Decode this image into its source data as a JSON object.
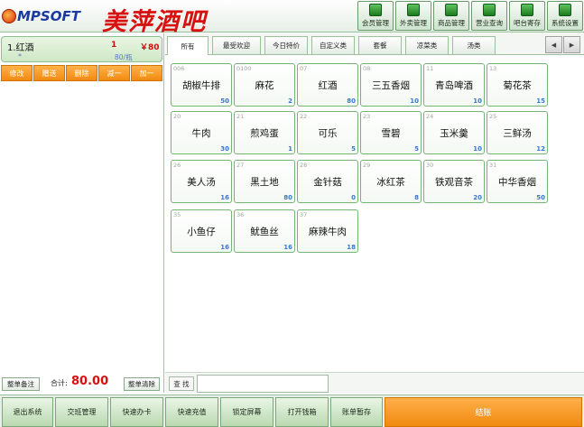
{
  "header": {
    "logo_text": "MPSOFT",
    "brand": "美萍酒吧",
    "nav": [
      {
        "label": "会员管理",
        "icon": "member-icon"
      },
      {
        "label": "外卖管理",
        "icon": "delivery-icon"
      },
      {
        "label": "商品管理",
        "icon": "goods-icon"
      },
      {
        "label": "营业查询",
        "icon": "yen-icon"
      },
      {
        "label": "吧台寄存",
        "icon": "storage-icon"
      },
      {
        "label": "系统设置",
        "icon": "gear-icon"
      }
    ]
  },
  "order": {
    "items": [
      {
        "name": "1.红酒",
        "qty": "1",
        "price": "￥80",
        "star": "*",
        "unit": "80/瓶"
      }
    ],
    "ops": [
      "修改",
      "赠送",
      "删除",
      "减一",
      "加一"
    ],
    "note_button": "整单备注",
    "total_label": "合计:",
    "total_value": "80.00",
    "clear_button": "整单清除"
  },
  "tabs": [
    "所有",
    "最受欢迎",
    "今日特价",
    "自定义类",
    "套餐",
    "凉菜类",
    "汤类"
  ],
  "products": [
    {
      "code": "006",
      "name": "胡椒牛排",
      "stock": "50"
    },
    {
      "code": "0100",
      "name": "麻花",
      "stock": "2"
    },
    {
      "code": "07",
      "name": "红酒",
      "stock": "80"
    },
    {
      "code": "08",
      "name": "三五香烟",
      "stock": "10"
    },
    {
      "code": "11",
      "name": "青岛啤酒",
      "stock": "10"
    },
    {
      "code": "13",
      "name": "菊花茶",
      "stock": "15"
    },
    {
      "code": "20",
      "name": "牛肉",
      "stock": "30"
    },
    {
      "code": "21",
      "name": "煎鸡蛋",
      "stock": "1"
    },
    {
      "code": "22",
      "name": "可乐",
      "stock": "5"
    },
    {
      "code": "23",
      "name": "雪碧",
      "stock": "5"
    },
    {
      "code": "24",
      "name": "玉米羹",
      "stock": "10"
    },
    {
      "code": "25",
      "name": "三鲜汤",
      "stock": "12"
    },
    {
      "code": "26",
      "name": "美人汤",
      "stock": "16"
    },
    {
      "code": "27",
      "name": "黑土地",
      "stock": "80"
    },
    {
      "code": "28",
      "name": "金针菇",
      "stock": "0"
    },
    {
      "code": "29",
      "name": "冰红茶",
      "stock": "8"
    },
    {
      "code": "30",
      "name": "铁观音茶",
      "stock": "20"
    },
    {
      "code": "31",
      "name": "中华香烟",
      "stock": "50"
    },
    {
      "code": "35",
      "name": "小鱼仔",
      "stock": "16"
    },
    {
      "code": "36",
      "name": "鱿鱼丝",
      "stock": "16"
    },
    {
      "code": "37",
      "name": "麻辣牛肉",
      "stock": "18"
    }
  ],
  "search": {
    "label": "查 找",
    "value": ""
  },
  "bottom": [
    "退出系统",
    "交班管理",
    "快速办卡",
    "快速充值",
    "锁定屏幕",
    "打开钱箱",
    "账单暂存",
    "结账"
  ]
}
